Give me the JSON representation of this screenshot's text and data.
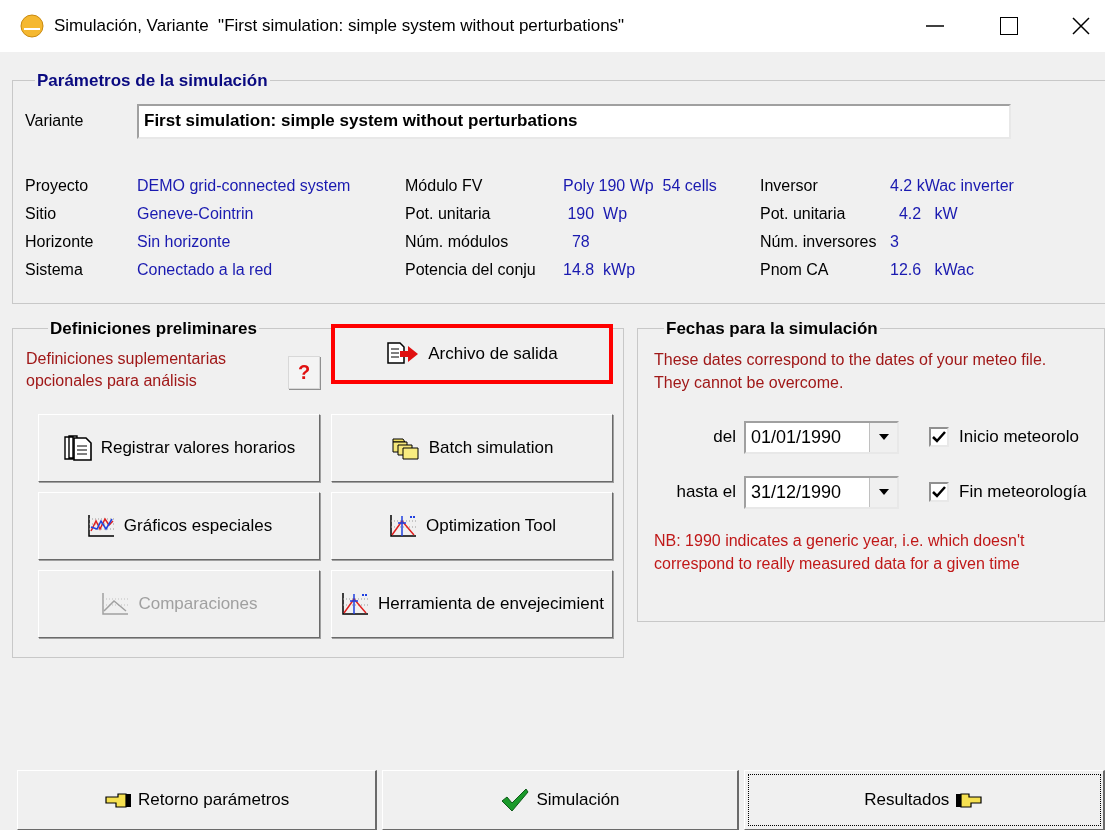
{
  "window": {
    "title": "Simulación, Variante  \"First simulation: simple system without perturbations\""
  },
  "parameters": {
    "title": "Parámetros de la simulación",
    "variant_label": "Variante",
    "variant_value": "First simulation: simple system without perturbations",
    "columns": [
      [
        {
          "label": "Proyecto",
          "value": "DEMO grid-connected system"
        },
        {
          "label": "Sitio",
          "value": "Geneve-Cointrin"
        },
        {
          "label": "Horizonte",
          "value": "Sin horizonte"
        },
        {
          "label": "Sistema",
          "value": "Conectado a la red"
        }
      ],
      [
        {
          "label": "Módulo FV",
          "value": "Poly 190 Wp  54 cells"
        },
        {
          "label": "Pot. unitaria",
          "value": " 190  Wp"
        },
        {
          "label": "Núm. módulos",
          "value": "  78"
        },
        {
          "label": "Potencia del conju",
          "value": "14.8  kWp"
        }
      ],
      [
        {
          "label": "Inversor",
          "value": "4.2 kWac inverter"
        },
        {
          "label": "Pot. unitaria",
          "value": "  4.2   kW"
        },
        {
          "label": "Núm. inversores",
          "value": "3"
        },
        {
          "label": "Pnom CA",
          "value": "12.6   kWac"
        }
      ]
    ]
  },
  "preliminary": {
    "title": "Definiciones preliminares",
    "note": "Definiciones suplementarias opcionales para análisis",
    "help": "?",
    "buttons": [
      {
        "label": "Archivo de salida",
        "disabled": false,
        "highlighted": true
      },
      {
        "label": "Registrar valores horarios",
        "disabled": false,
        "highlighted": false
      },
      {
        "label": "Batch simulation",
        "disabled": false,
        "highlighted": false
      },
      {
        "label": "Gráficos especiales",
        "disabled": false,
        "highlighted": false
      },
      {
        "label": "Optimization Tool",
        "disabled": false,
        "highlighted": false
      },
      {
        "label": "Comparaciones",
        "disabled": true,
        "highlighted": false
      },
      {
        "label": "Herramienta de envejecimient",
        "disabled": false,
        "highlighted": false
      }
    ]
  },
  "dates": {
    "title": "Fechas para la simulación",
    "note": "These dates correspond to the dates of  your meteo file. They cannot be overcome.",
    "rows": [
      {
        "label": "del",
        "value": "01/01/1990",
        "check_label": "Inicio meteorolo",
        "checked": true
      },
      {
        "label": "hasta el",
        "value": "31/12/1990",
        "check_label": "Fin meteorología",
        "checked": true
      }
    ],
    "footnote": "NB: 1990 indicates a generic year, i.e. which doesn't correspond to really measured data for a given time"
  },
  "footer": [
    {
      "label": "Retorno parámetros",
      "focused": false
    },
    {
      "label": "Simulación",
      "focused": false
    },
    {
      "label": "Resultados",
      "focused": true
    }
  ]
}
